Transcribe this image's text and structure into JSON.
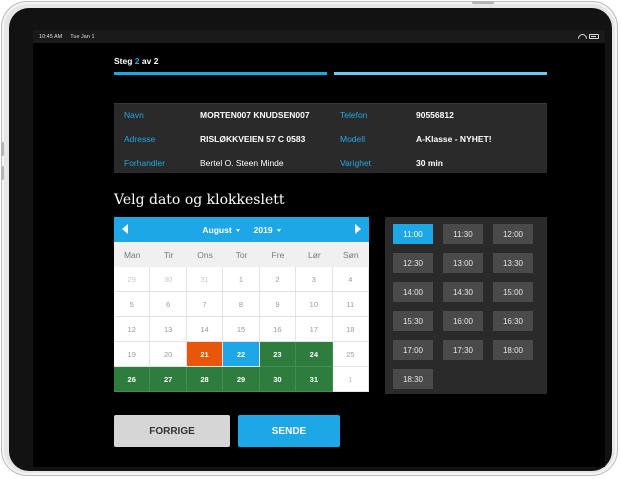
{
  "status_bar": {
    "time": "10:45 AM",
    "date": "Tue Jan 1"
  },
  "step": {
    "prefix": "Steg",
    "current": "2",
    "separator": "av",
    "total": "2"
  },
  "colors": {
    "accent": "#1ea7e6",
    "today": "#e8560a",
    "available": "#2e7d3f"
  },
  "info": {
    "navn_label": "Navn",
    "navn_value": "MORTEN007 KNUDSEN007",
    "telefon_label": "Telefon",
    "telefon_value": "90556812",
    "adresse_label": "Adresse",
    "adresse_value": "RISLØKKVEIEN 57 C 0583",
    "modell_label": "Modell",
    "modell_value": "A-Klasse - NYHET!",
    "forhandler_label": "Forhandler",
    "forhandler_value": "Bertel O. Steen Minde",
    "varighet_label": "Varighet",
    "varighet_value": "30 min"
  },
  "heading": "Velg dato og klokkeslett",
  "calendar": {
    "month": "August",
    "year": "2019",
    "weekdays": [
      "Man",
      "Tir",
      "Ons",
      "Tor",
      "Fre",
      "Lør",
      "Søn"
    ],
    "days": [
      {
        "d": "29",
        "s": "other"
      },
      {
        "d": "30",
        "s": "other"
      },
      {
        "d": "31",
        "s": "other"
      },
      {
        "d": "1",
        "s": "past"
      },
      {
        "d": "2",
        "s": "past"
      },
      {
        "d": "3",
        "s": "past"
      },
      {
        "d": "4",
        "s": "past"
      },
      {
        "d": "5",
        "s": "past"
      },
      {
        "d": "6",
        "s": "past"
      },
      {
        "d": "7",
        "s": "past"
      },
      {
        "d": "8",
        "s": "past"
      },
      {
        "d": "9",
        "s": "past"
      },
      {
        "d": "10",
        "s": "past"
      },
      {
        "d": "11",
        "s": "past"
      },
      {
        "d": "12",
        "s": "past"
      },
      {
        "d": "13",
        "s": "past"
      },
      {
        "d": "14",
        "s": "past"
      },
      {
        "d": "15",
        "s": "past"
      },
      {
        "d": "16",
        "s": "past"
      },
      {
        "d": "17",
        "s": "past"
      },
      {
        "d": "18",
        "s": "past"
      },
      {
        "d": "19",
        "s": "past"
      },
      {
        "d": "20",
        "s": "past"
      },
      {
        "d": "21",
        "s": "today"
      },
      {
        "d": "22",
        "s": "selected"
      },
      {
        "d": "23",
        "s": "available"
      },
      {
        "d": "24",
        "s": "available"
      },
      {
        "d": "25",
        "s": "past"
      },
      {
        "d": "26",
        "s": "available"
      },
      {
        "d": "27",
        "s": "available"
      },
      {
        "d": "28",
        "s": "available"
      },
      {
        "d": "29",
        "s": "available"
      },
      {
        "d": "30",
        "s": "available"
      },
      {
        "d": "31",
        "s": "available"
      },
      {
        "d": "1",
        "s": "disabled"
      }
    ]
  },
  "times": {
    "selected": "11:00",
    "slots": [
      "11:00",
      "11:30",
      "12:00",
      "12:30",
      "13:00",
      "13:30",
      "14:00",
      "14:30",
      "15:00",
      "15:30",
      "16:00",
      "16:30",
      "17:00",
      "17:30",
      "18:00",
      "18:30"
    ]
  },
  "buttons": {
    "back": "FORRIGE",
    "send": "SENDE"
  }
}
